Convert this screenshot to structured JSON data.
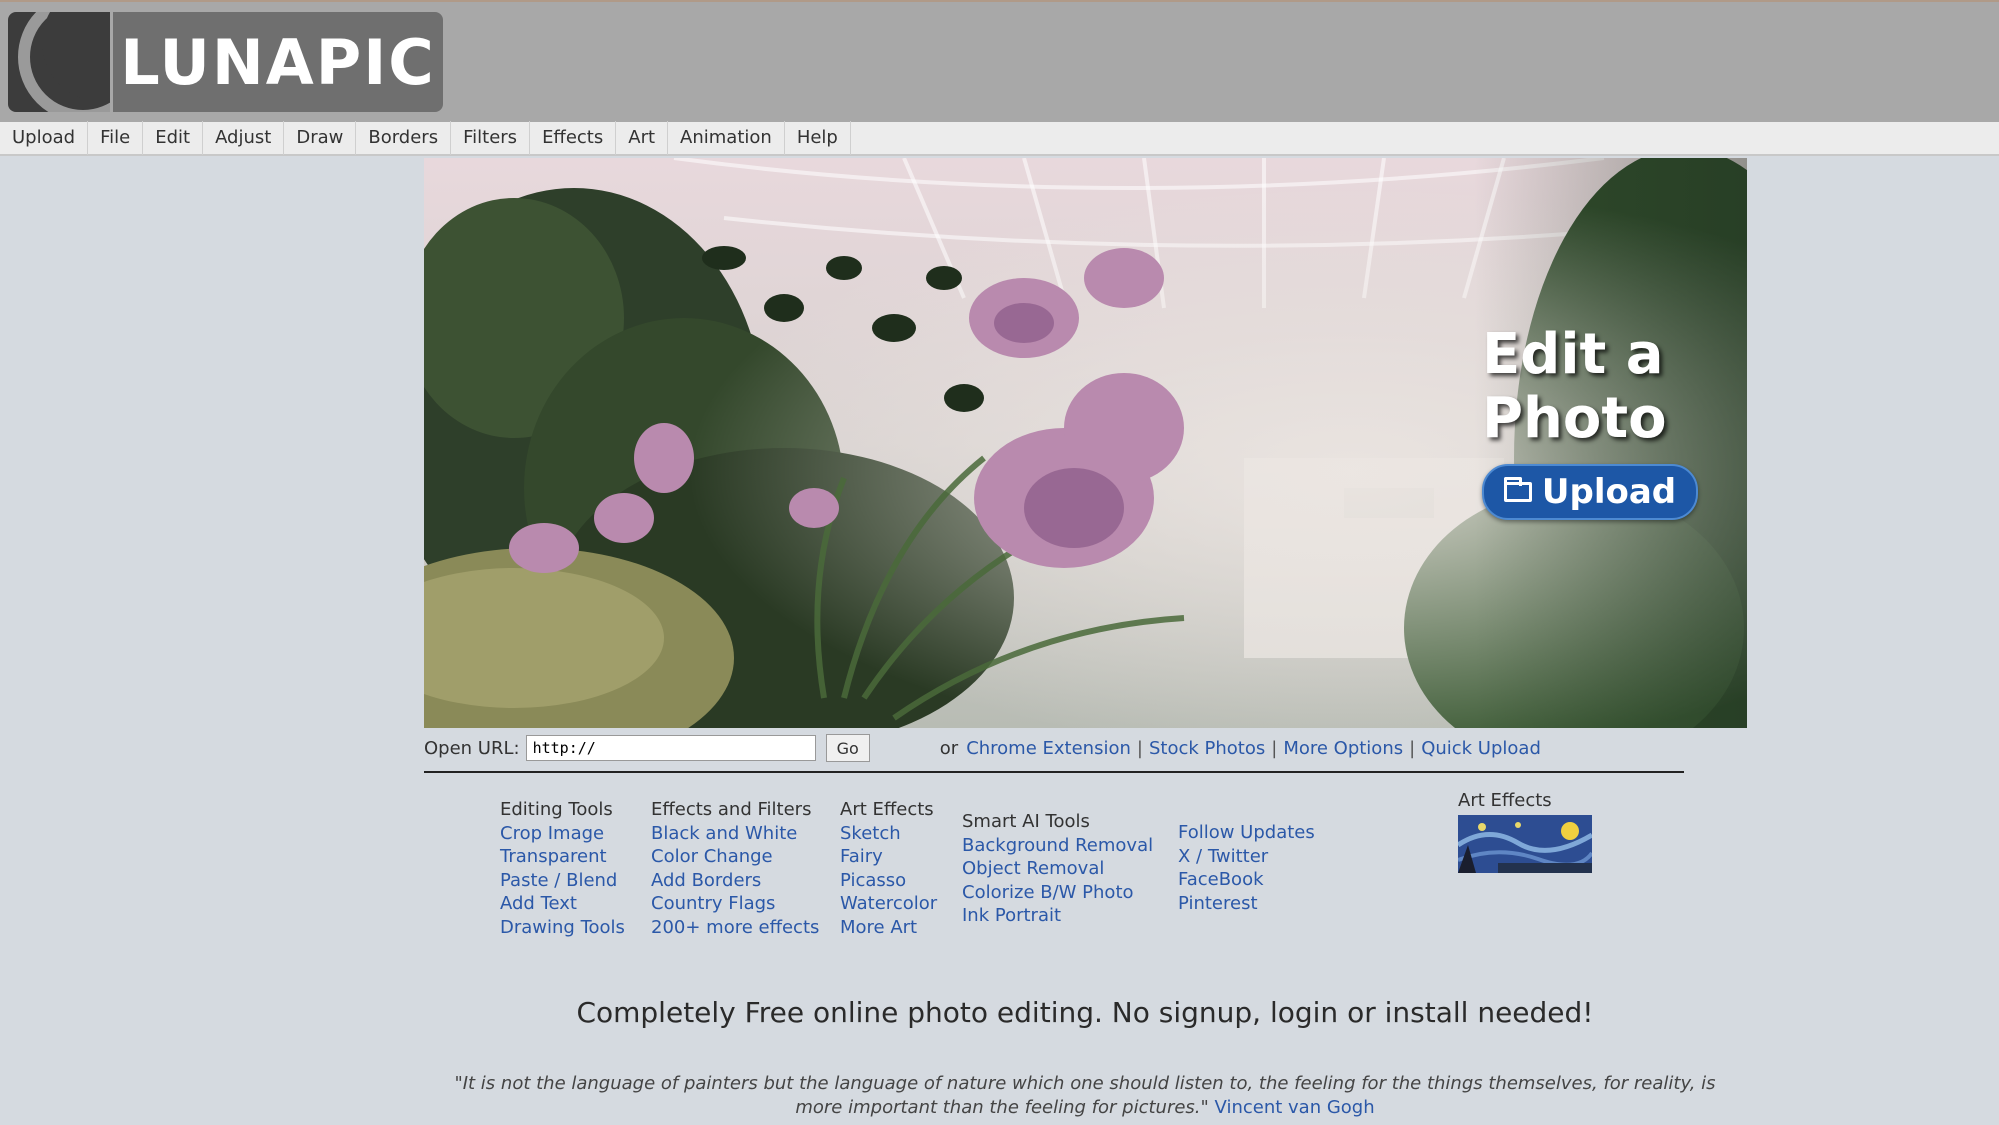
{
  "logo": {
    "text": "LUNAPIC"
  },
  "menu": [
    "Upload",
    "File",
    "Edit",
    "Adjust",
    "Draw",
    "Borders",
    "Filters",
    "Effects",
    "Art",
    "Animation",
    "Help"
  ],
  "hero": {
    "title_line1": "Edit a",
    "title_line2": "Photo",
    "upload_label": "Upload",
    "upload_icon": "folder-icon"
  },
  "url_bar": {
    "label": "Open URL:",
    "value": "http://",
    "go_label": "Go",
    "or_text": "or",
    "links": [
      "Chrome Extension",
      "Stock Photos",
      "More Options",
      "Quick Upload"
    ],
    "separator": "|"
  },
  "columns": {
    "editing": {
      "heading": "Editing Tools",
      "links": [
        "Crop Image",
        "Transparent",
        "Paste / Blend",
        "Add Text",
        "Drawing Tools"
      ]
    },
    "effects": {
      "heading": "Effects and Filters",
      "links": [
        "Black and White",
        "Color Change",
        "Add Borders",
        "Country Flags",
        "200+ more effects"
      ]
    },
    "art": {
      "heading": "Art Effects",
      "links": [
        "Sketch",
        "Fairy",
        "Picasso",
        "Watercolor",
        "More Art"
      ]
    },
    "smart_ai": {
      "heading": "Smart AI Tools",
      "links": [
        "Background Removal",
        "Object Removal",
        "Colorize B/W Photo",
        "Ink Portrait"
      ]
    },
    "follow": {
      "heading": "",
      "links": [
        "Follow Updates",
        "X / Twitter",
        "FaceBook",
        "Pinterest"
      ]
    }
  },
  "art_effects_box": {
    "title": "Art Effects"
  },
  "tagline": "Completely Free online photo editing. No signup, login or install needed!",
  "quote": {
    "text": "\"It is not the language of painters but the language of nature which one should listen to, the feeling for the things themselves, for reality, is more important than the feeling for pictures.\"",
    "author": "Vincent van Gogh"
  },
  "colors": {
    "link": "#2b58a8",
    "upload_button": "#1d57a6",
    "background": "#d5dae0"
  }
}
